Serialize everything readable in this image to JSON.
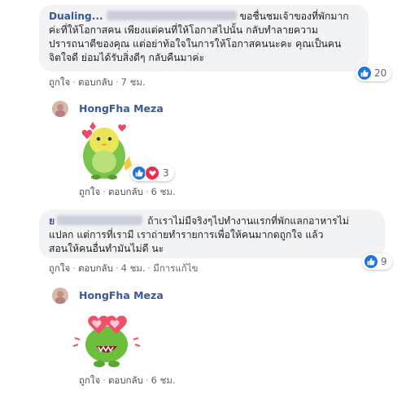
{
  "colors": {
    "link": "#385898",
    "bubble": "#f2f3f5",
    "like": "#1b74e4",
    "love": "#f0284a",
    "meta": "#606770"
  },
  "comment1": {
    "author": "Dualing...",
    "line1": "ขอชื่นชมเจ้าของที่พักมาก",
    "line2": "ค่ะที่ให้โอกาสคน เพียงแต่คนที่ให้โอกาสไปนั้น กลับทำลายความ",
    "line3": "ปรารถนาดีของคุณ แต่อย่าท้อใจในการให้โอกาสคนนะคะ คุณเป็นคน",
    "line4": "จิตใจดี ย่อมได้รับสิ่งดีๆ กลับคืนมาค่ะ",
    "like": "ถูกใจ",
    "reply": "ตอบกลับ",
    "time": "7 ชม.",
    "reaction_icon": "like-icon",
    "reaction_count": "20"
  },
  "reply1": {
    "author": "HongFha Meza",
    "sticker": "green-parrot-hearts-sticker",
    "like": "ถูกใจ",
    "reply": "ตอบกลับ",
    "time": "6 ชม.",
    "reaction_icons": [
      "like-icon",
      "love-icon"
    ],
    "reaction_count": "3"
  },
  "comment2": {
    "author": "ย",
    "line1": "ถ้าเราไม่มีจริงๆไปทำงานแรกที่พักแลกอาหารไม่",
    "line2": "แปลก แต่การที่เรามี เราถ่ายทำรายการเพื่อให้คนมากดถูกใจ แล้ว",
    "line3": "สอนให้คนอื่นทำมันไม่ดี นะ",
    "like": "ถูกใจ",
    "reply": "ตอบกลับ",
    "time": "4 ชม.",
    "edited": "มีการแก้ไข",
    "reaction_icon": "like-icon",
    "reaction_count": "9"
  },
  "reply2": {
    "author": "HongFha Meza",
    "sticker": "om-nom-heart-eyes-sticker",
    "like": "ถูกใจ",
    "reply": "ตอบกลับ",
    "time": "6 ชม."
  }
}
